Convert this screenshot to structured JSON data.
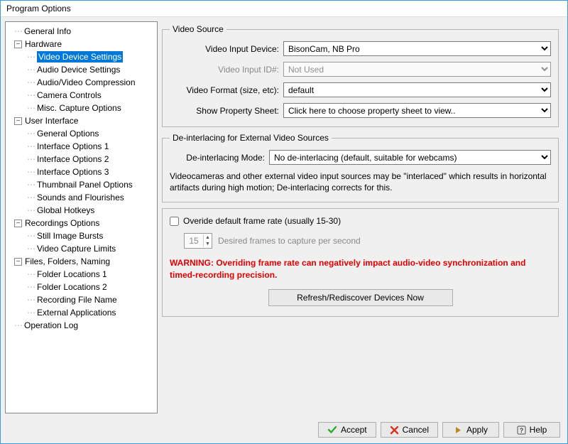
{
  "window": {
    "title": "Program Options"
  },
  "tree": {
    "items": [
      {
        "label": "General Info",
        "level": 0,
        "expand": null
      },
      {
        "label": "Hardware",
        "level": 0,
        "expand": "-"
      },
      {
        "label": "Video Device Settings",
        "level": 1,
        "selected": true
      },
      {
        "label": "Audio Device Settings",
        "level": 1
      },
      {
        "label": "Audio/Video Compression",
        "level": 1
      },
      {
        "label": "Camera Controls",
        "level": 1
      },
      {
        "label": "Misc. Capture Options",
        "level": 1
      },
      {
        "label": "User Interface",
        "level": 0,
        "expand": "-"
      },
      {
        "label": "General Options",
        "level": 1
      },
      {
        "label": "Interface Options 1",
        "level": 1
      },
      {
        "label": "Interface Options 2",
        "level": 1
      },
      {
        "label": "Interface Options 3",
        "level": 1
      },
      {
        "label": "Thumbnail Panel Options",
        "level": 1
      },
      {
        "label": "Sounds and Flourishes",
        "level": 1
      },
      {
        "label": "Global Hotkeys",
        "level": 1
      },
      {
        "label": "Recordings Options",
        "level": 0,
        "expand": "-"
      },
      {
        "label": "Still Image Bursts",
        "level": 1
      },
      {
        "label": "Video Capture Limits",
        "level": 1
      },
      {
        "label": "Files, Folders, Naming",
        "level": 0,
        "expand": "-"
      },
      {
        "label": "Folder Locations 1",
        "level": 1
      },
      {
        "label": "Folder Locations 2",
        "level": 1
      },
      {
        "label": "Recording File Name",
        "level": 1
      },
      {
        "label": "External Applications",
        "level": 1
      },
      {
        "label": "Operation Log",
        "level": 0,
        "expand": null
      }
    ]
  },
  "videoSource": {
    "legend": "Video Source",
    "inputDevice": {
      "label": "Video Input Device:",
      "value": "BisonCam, NB Pro"
    },
    "inputId": {
      "label": "Video Input ID#:",
      "value": "Not Used",
      "disabled": true
    },
    "format": {
      "label": "Video Format (size, etc):",
      "value": "default"
    },
    "propSheet": {
      "label": "Show Property Sheet:",
      "value": "Click here to choose property sheet to view.."
    }
  },
  "deinterlace": {
    "legend": "De-interlacing for External Video Sources",
    "mode": {
      "label": "De-interlacing Mode:",
      "value": "No de-interlacing (default, suitable for webcams)"
    },
    "help": "Videocameras and other external video input sources may be \"interlaced\" which results in horizontal artifacts during high motion; De-interlacing corrects for this."
  },
  "frameRate": {
    "overrideLabel": "Overide default frame rate (usually 15-30)",
    "value": "15",
    "desired": "Desired frames to capture per second",
    "warning": "WARNING: Overiding frame rate can negatively impact audio-video synchronization and timed-recording precision."
  },
  "refreshButton": "Refresh/Rediscover Devices Now",
  "buttons": {
    "accept": "Accept",
    "cancel": "Cancel",
    "apply": "Apply",
    "help": "Help"
  }
}
